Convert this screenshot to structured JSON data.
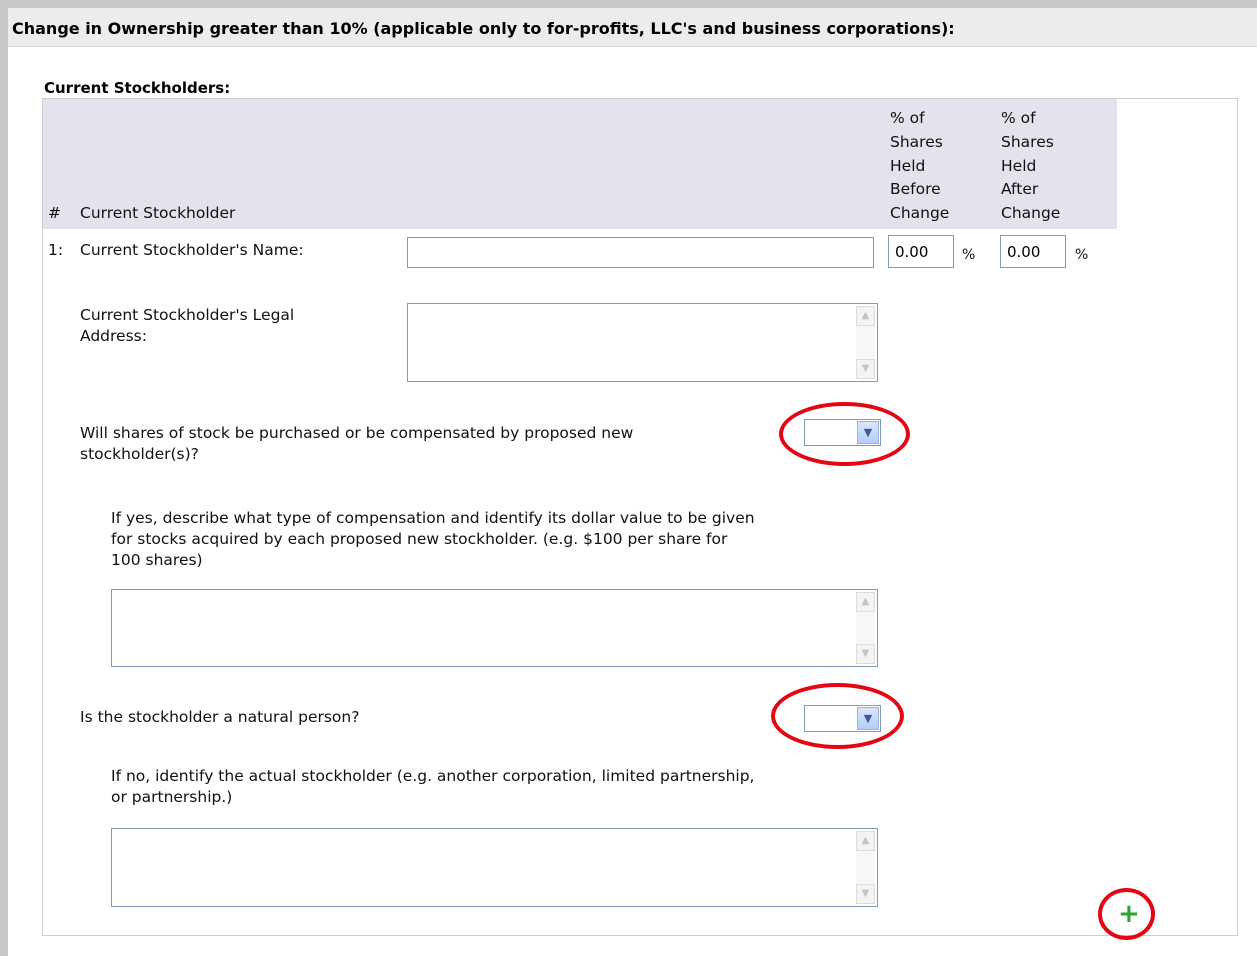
{
  "header": {
    "title": "Change in Ownership greater than 10% (applicable only to for-profits, LLC's and business corporations):"
  },
  "section": {
    "title": "Current Stockholders:"
  },
  "table": {
    "columns": {
      "number": "#",
      "stockholder": "Current Stockholder",
      "before": [
        "% of",
        "Shares",
        "Held",
        "Before",
        "Change"
      ],
      "after": [
        "% of",
        "Shares",
        "Held",
        "After",
        "Change"
      ]
    },
    "row": {
      "number": "1:",
      "name_label": "Current Stockholder's Name:",
      "name_value": "",
      "before_value": "0.00",
      "after_value": "0.00",
      "percent_sign": "%",
      "address_label_line1": "Current Stockholder's Legal",
      "address_label_line2": "Address:",
      "address_value": "",
      "purchase_question_line1": "Will shares of stock be purchased or be compensated by proposed new",
      "purchase_question_line2": "stockholder(s)?",
      "purchase_selected": "",
      "compensation_desc_line1": "If yes, describe what type of compensation and identify its dollar value to be given",
      "compensation_desc_line2": "for stocks acquired by each proposed new stockholder. (e.g. $100 per share for",
      "compensation_desc_line3": "100 shares)",
      "compensation_value": "",
      "natural_person_question": "Is the stockholder a natural person?",
      "natural_person_selected": "",
      "actual_desc_line1": "If no, identify the actual stockholder (e.g. another corporation, limited partnership,",
      "actual_desc_line2": "or partnership.)",
      "actual_value": ""
    },
    "add_row_symbol": "+"
  },
  "icons": {
    "scroll_up": "scroll-up-arrow-icon",
    "scroll_down": "scroll-down-arrow-icon",
    "dropdown": "chevron-down-icon",
    "add": "plus-icon"
  },
  "colors": {
    "header_band": "#ececec",
    "table_header": "#e3e3ee",
    "input_border": "#7f9db9",
    "annotation_red": "#e30613",
    "add_green": "#2ca52c"
  }
}
